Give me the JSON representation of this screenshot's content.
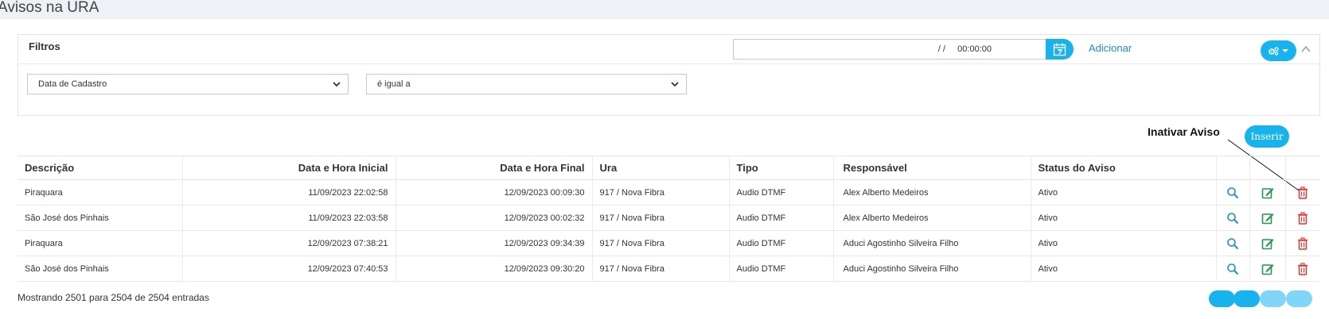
{
  "page": {
    "title": "Avisos na URA"
  },
  "filters": {
    "title": "Filtros",
    "field_select": "Data de Cadastro",
    "operator_select": "é igual a",
    "date_value": "/ /     00:00:00",
    "add_label": "Adicionar",
    "settings_icon": "gears-icon",
    "accent": "#17b3ee"
  },
  "annotation": {
    "label": "Inativar Aviso"
  },
  "toolbar": {
    "insert_label": "Inserir"
  },
  "table": {
    "columns": [
      "Descrição",
      "Data e Hora Inicial",
      "Data e Hora Final",
      "Ura",
      "Tipo",
      "Responsável",
      "Status do Aviso"
    ],
    "rows": [
      {
        "descricao": "Piraquara",
        "inicial": "11/09/2023 22:02:58",
        "final": "12/09/2023 00:09:30",
        "ura": "917 / Nova Fibra",
        "tipo": "Audio DTMF",
        "responsavel": "Alex Alberto Medeiros",
        "status": "Ativo"
      },
      {
        "descricao": "São José dos Pinhais",
        "inicial": "11/09/2023 22:03:58",
        "final": "12/09/2023 00:02:32",
        "ura": "917 / Nova Fibra",
        "tipo": "Audio DTMF",
        "responsavel": "Alex Alberto Medeiros",
        "status": "Ativo"
      },
      {
        "descricao": "Piraquara",
        "inicial": "12/09/2023 07:38:21",
        "final": "12/09/2023 09:34:39",
        "ura": "917 / Nova Fibra",
        "tipo": "Audio DTMF",
        "responsavel": "Aduci Agostinho Silveira Filho",
        "status": "Ativo"
      },
      {
        "descricao": "São José dos Pinhais",
        "inicial": "12/09/2023 07:40:53",
        "final": "12/09/2023 09:30:20",
        "ura": "917 / Nova Fibra",
        "tipo": "Audio DTMF",
        "responsavel": "Aduci Agostinho Silveira Filho",
        "status": "Ativo"
      }
    ],
    "row_icons": [
      "search-icon",
      "edit-icon",
      "trash-icon"
    ],
    "icon_colors": {
      "search": "#1a8fd1",
      "edit": "#1e9a4a",
      "trash": "#e0392f"
    }
  },
  "footer": {
    "info": "Mostrando 2501 para 2504 de 2504 entradas"
  }
}
